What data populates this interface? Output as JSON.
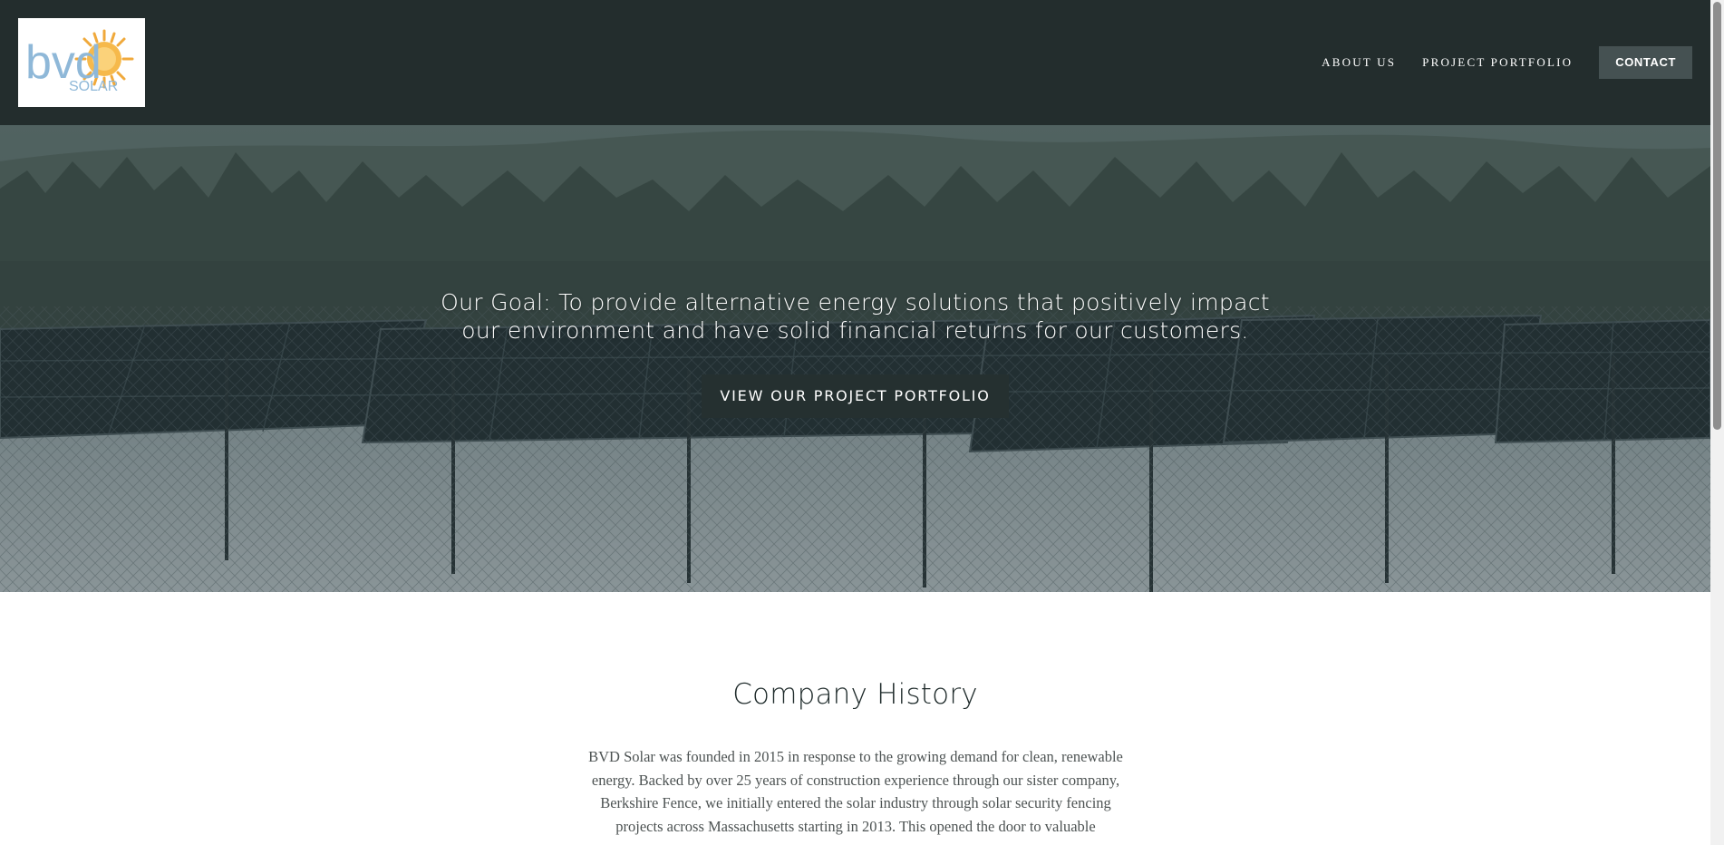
{
  "header": {
    "logo": {
      "text_main": "bvd",
      "text_sub": "SOLAR"
    },
    "nav": {
      "about_label": "About Us",
      "portfolio_label": "Project Portfolio",
      "contact_label": "Contact"
    }
  },
  "hero": {
    "line1": "Our Goal: To provide alternative energy solutions that positively impact",
    "line2": "our environment and have solid financial returns for our customers.",
    "button_label": "View Our Project Portfolio"
  },
  "history": {
    "title": "Company History",
    "lines": [
      "BVD Solar was founded in 2015 in response to the growing demand for clean, renewable",
      "energy. Backed by over 25 years of construction experience through our sister company,",
      "Berkshire Fence, we initially entered the solar industry through solar security fencing",
      "projects across Massachusetts starting in 2013. This opened the door to valuable"
    ]
  },
  "colors": {
    "header_bg": "#232d2d",
    "contact_bg": "#455152",
    "hero_button_bg": "#253030",
    "logo_blue": "#8fb8d8",
    "logo_orange": "#f0a93b"
  }
}
